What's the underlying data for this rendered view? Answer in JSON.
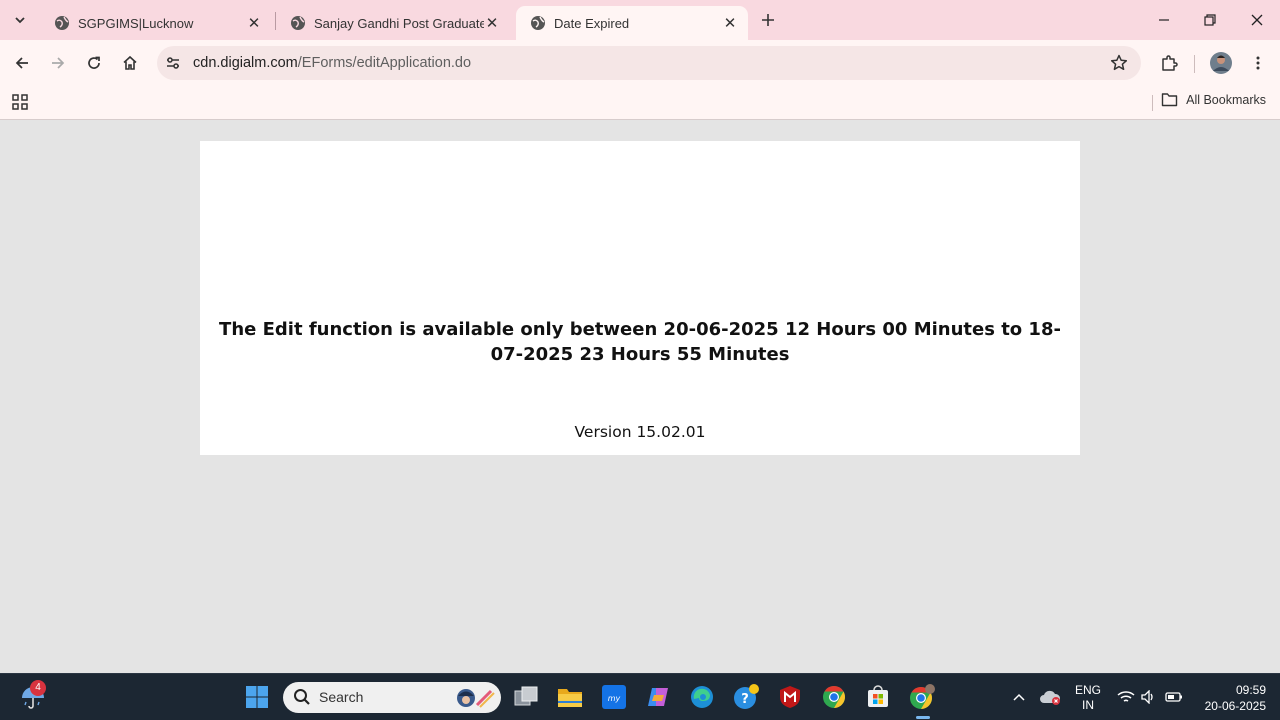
{
  "browser": {
    "tabs": [
      {
        "title": "SGPGIMS|Lucknow",
        "active": false
      },
      {
        "title": "Sanjay Gandhi Post Graduate In",
        "active": false
      },
      {
        "title": "Date Expired",
        "active": true
      }
    ],
    "address": {
      "host": "cdn.digialm.com",
      "path": "/EForms/editApplication.do"
    },
    "bookmarks": {
      "all_bookmarks_label": "All Bookmarks"
    }
  },
  "page": {
    "message": "The Edit function is available only between 20-06-2025 12 Hours 00 Minutes to 18-07-2025 23 Hours 55 Minutes",
    "version": "Version 15.02.01"
  },
  "taskbar": {
    "weather_badge": "4",
    "search_label": "Search",
    "language": {
      "line1": "ENG",
      "line2": "IN"
    },
    "clock": {
      "time": "09:59",
      "date": "20-06-2025"
    }
  },
  "colors": {
    "tabstrip_bg": "#f9d9e0",
    "toolbar_bg": "#fff5f4",
    "page_bg": "#e4e4e4",
    "card_bg": "#ffffff",
    "taskbar_bg": "#1c2733"
  }
}
